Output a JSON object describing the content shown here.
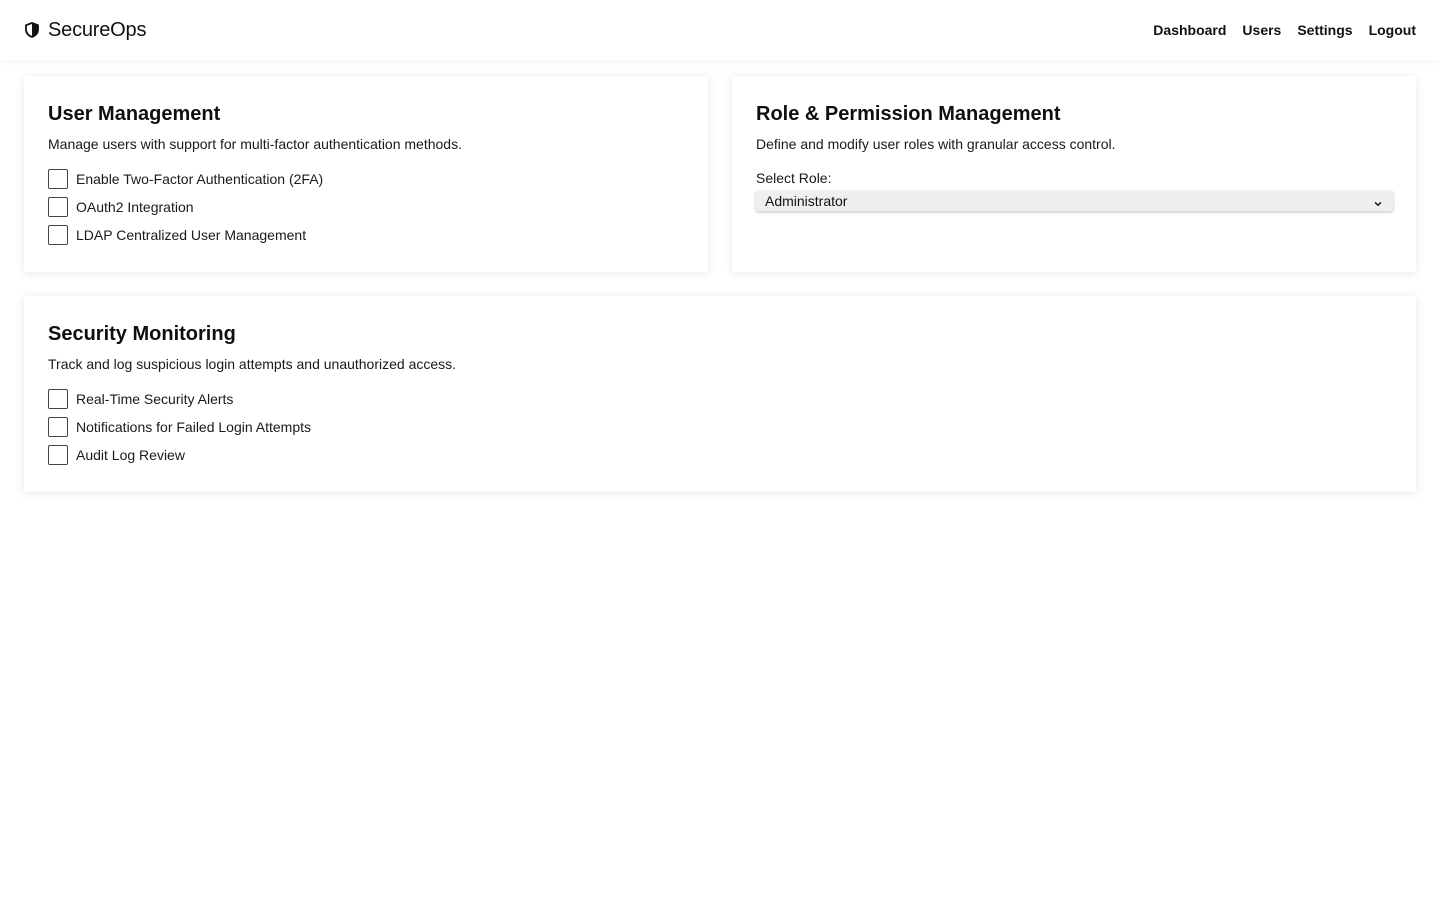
{
  "navbar": {
    "brand": "SecureOps",
    "brand_icon": "shield-icon",
    "links": [
      "Dashboard",
      "Users",
      "Settings",
      "Logout"
    ]
  },
  "user_management": {
    "title": "User Management",
    "description": "Manage users with support for multi-factor authentication methods.",
    "options": [
      {
        "label": "Enable Two-Factor Authentication (2FA)",
        "checked": false
      },
      {
        "label": "OAuth2 Integration",
        "checked": false
      },
      {
        "label": "LDAP Centralized User Management",
        "checked": false
      }
    ]
  },
  "role_permission": {
    "title": "Role & Permission Management",
    "description": "Define and modify user roles with granular access control.",
    "select_label": "Select Role:",
    "selected_role": "Administrator",
    "select_icon": "chevron-down-icon"
  },
  "security_monitoring": {
    "title": "Security Monitoring",
    "description": "Track and log suspicious login attempts and unauthorized access.",
    "options": [
      {
        "label": "Real-Time Security Alerts",
        "checked": false
      },
      {
        "label": "Notifications for Failed Login Attempts",
        "checked": false
      },
      {
        "label": "Audit Log Review",
        "checked": false
      }
    ]
  }
}
